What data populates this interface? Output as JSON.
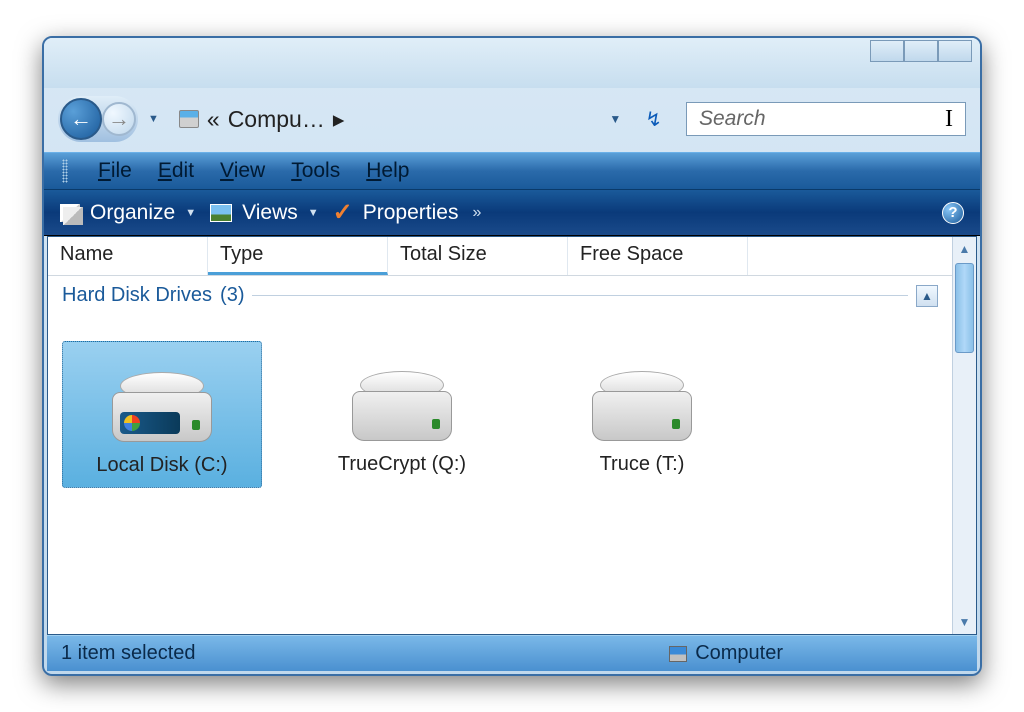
{
  "address": {
    "location_text": "Compu…",
    "separator_left": "«",
    "separator_right": "▸"
  },
  "search": {
    "placeholder": "Search"
  },
  "menubar": {
    "file": "File",
    "edit": "Edit",
    "view": "View",
    "tools": "Tools",
    "help": "Help"
  },
  "toolbar": {
    "organize": "Organize",
    "views": "Views",
    "properties": "Properties"
  },
  "columns": {
    "name": "Name",
    "type": "Type",
    "total_size": "Total Size",
    "free_space": "Free Space"
  },
  "group": {
    "label": "Hard Disk Drives",
    "count": "(3)"
  },
  "drives": [
    {
      "label": "Local Disk (C:)",
      "selected": true,
      "system": true
    },
    {
      "label": "TrueCrypt (Q:)",
      "selected": false,
      "system": false
    },
    {
      "label": "Truce (T:)",
      "selected": false,
      "system": false
    }
  ],
  "statusbar": {
    "left": "1 item selected",
    "right": "Computer"
  }
}
